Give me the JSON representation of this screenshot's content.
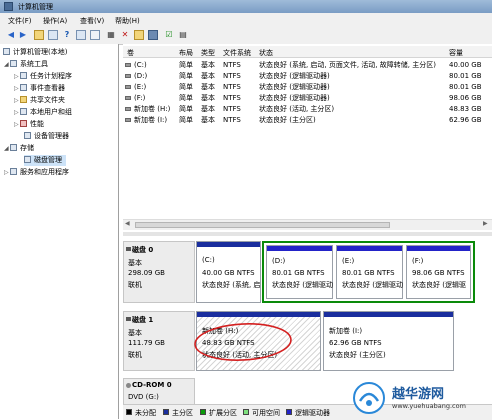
{
  "window": {
    "title": "计算机管理"
  },
  "menu": [
    "文件(F)",
    "操作(A)",
    "查看(V)",
    "帮助(H)"
  ],
  "tree": {
    "root": "计算机管理(本地)",
    "system_tools": "系统工具",
    "task_scheduler": "任务计划程序",
    "event_viewer": "事件查看器",
    "shared_folders": "共享文件夹",
    "local_users": "本地用户和组",
    "performance": "性能",
    "device_manager": "设备管理器",
    "storage": "存储",
    "disk_management": "磁盘管理",
    "services": "服务和应用程序"
  },
  "volume_table": {
    "headers": [
      "卷",
      "布局",
      "类型",
      "文件系统",
      "状态",
      "容量"
    ],
    "rows": [
      [
        "(C:)",
        "简单",
        "基本",
        "NTFS",
        "状态良好 (系统, 启动, 页面文件, 活动, 故障转储, 主分区)",
        "40.00 GB"
      ],
      [
        "(D:)",
        "简单",
        "基本",
        "NTFS",
        "状态良好 (逻辑驱动器)",
        "80.01 GB"
      ],
      [
        "(E:)",
        "简单",
        "基本",
        "NTFS",
        "状态良好 (逻辑驱动器)",
        "80.01 GB"
      ],
      [
        "(F:)",
        "简单",
        "基本",
        "NTFS",
        "状态良好 (逻辑驱动器)",
        "98.06 GB"
      ],
      [
        "新加卷 (H:)",
        "简单",
        "基本",
        "NTFS",
        "状态良好 (活动, 主分区)",
        "48.83 GB"
      ],
      [
        "新加卷 (I:)",
        "简单",
        "基本",
        "NTFS",
        "状态良好 (主分区)",
        "62.96 GB"
      ]
    ]
  },
  "disk0": {
    "name": "磁盘 0",
    "type": "基本",
    "size": "298.09 GB",
    "status": "联机",
    "partitions": [
      {
        "label": "(C:)",
        "size": "40.00 GB NTFS",
        "status": "状态良好 (系统, 启"
      },
      {
        "label": "(D:)",
        "size": "80.01 GB NTFS",
        "status": "状态良好 (逻辑驱动"
      },
      {
        "label": "(E:)",
        "size": "80.01 GB NTFS",
        "status": "状态良好 (逻辑驱动"
      },
      {
        "label": "(F:)",
        "size": "98.06 GB NTFS",
        "status": "状态良好 (逻辑驱"
      }
    ]
  },
  "disk1": {
    "name": "磁盘 1",
    "type": "基本",
    "size": "111.79 GB",
    "status": "联机",
    "partitions": [
      {
        "label": "新加卷 (H:)",
        "size": "48.83 GB NTFS",
        "status": "状态良好 (活动, 主分区)"
      },
      {
        "label": "新加卷 (I:)",
        "size": "62.96 GB NTFS",
        "status": "状态良好 (主分区)"
      }
    ]
  },
  "cdrom": {
    "name": "CD-ROM 0",
    "type": "DVD (G:)"
  },
  "legend": [
    "未分配",
    "主分区",
    "扩展分区",
    "可用空间",
    "逻辑驱动器"
  ],
  "colors": {
    "primary": "#1a2e9e",
    "logical": "#2323c8",
    "extended_border": "#0a8a0a",
    "annotation": "#d42020",
    "unallocated": "#000000",
    "extended": "#0a9a0a",
    "free": "#7ee07e"
  },
  "watermark": {
    "brand": "越华游网",
    "url": "www.yuehuabang.com"
  }
}
